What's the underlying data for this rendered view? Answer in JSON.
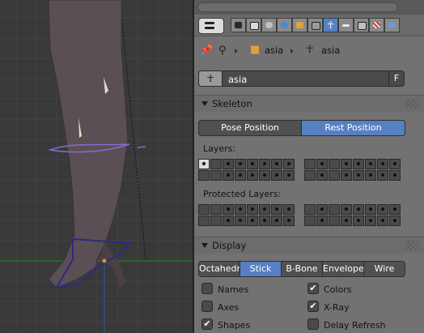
{
  "properties": {
    "breadcrumb": {
      "object_name": "asia",
      "armature_name": "asia"
    },
    "datablock": {
      "name": "asia",
      "fake_user_label": "F"
    },
    "skeleton": {
      "title": "Skeleton",
      "pose_position_label": "Pose Position",
      "rest_position_label": "Rest Position",
      "selected_position": "Rest Position",
      "layers_label": "Layers:",
      "protected_layers_label": "Protected Layers:"
    },
    "display": {
      "title": "Display",
      "modes": [
        "Octahedr",
        "Stick",
        "B-Bone",
        "Envelope",
        "Wire"
      ],
      "selected_mode": "Stick",
      "options": {
        "names_label": "Names",
        "names_checked": false,
        "colors_label": "Colors",
        "colors_checked": true,
        "axes_label": "Axes",
        "axes_checked": false,
        "xray_label": "X-Ray",
        "xray_checked": true,
        "shapes_label": "Shapes",
        "shapes_checked": true,
        "delay_refresh_label": "Delay Refresh",
        "delay_refresh_checked": false
      }
    },
    "accent_color": "#5680c2"
  },
  "icons": [
    "context-menu-icon",
    "render-icon",
    "layers-icon",
    "scene-icon",
    "world-icon",
    "object-icon",
    "constraints-icon",
    "armature-data-icon",
    "bone-icon",
    "bone-constraint-icon",
    "texture-icon",
    "physics-icon",
    "pin-icon",
    "cube-icon",
    "armature-icon"
  ]
}
